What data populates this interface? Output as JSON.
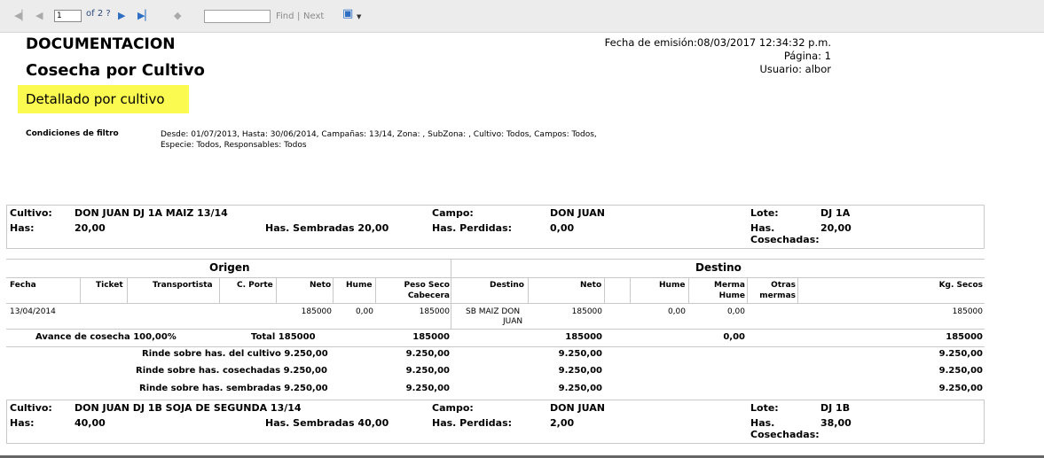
{
  "toolbar": {
    "first_icon": "first-page-icon",
    "prev_icon": "previous-page-icon",
    "page_value": "1",
    "page_of": "of 2 ?",
    "next_icon": "next-page-icon",
    "last_icon": "last-page-icon",
    "back_icon": "back-icon",
    "find_value": "",
    "find_label": "Find",
    "separator": "|",
    "next_label": "Next",
    "export_icon": "save-export-icon",
    "dropdown_icon": "dropdown-arrow-icon"
  },
  "report": {
    "title1": "DOCUMENTACION",
    "title2": "Cosecha por Cultivo",
    "subtitle": "Detallado por cultivo",
    "emision": "Fecha de emisión:08/03/2017 12:34:32 p.m.",
    "pagina": "Página: 1",
    "usuario": "Usuario: albor",
    "filter_label": "Condiciones de filtro",
    "filter_text": "Desde: 01/07/2013, Hasta: 30/06/2014, Campañas: 13/14, Zona: , SubZona: , Cultivo: Todos, Campos: Todos, Especie: Todos, Responsables: Todos"
  },
  "block1": {
    "cultivo_label": "Cultivo:",
    "cultivo_value": "DON JUAN DJ 1A MAIZ 13/14",
    "campo_label": "Campo:",
    "campo_value": "DON JUAN",
    "lote_label": "Lote:",
    "lote_value": "DJ 1A",
    "has_label": "Has:",
    "has_value": "20,00",
    "sembradas": "Has. Sembradas 20,00",
    "perdidas_label": "Has. Perdidas:",
    "perdidas_value": "0,00",
    "cosechadas_label1": "Has.",
    "cosechadas_label2": "Cosechadas:",
    "cosechadas_value": "20,00"
  },
  "table": {
    "origen": "Origen",
    "destino": "Destino",
    "col_fecha": "Fecha",
    "col_ticket": "Ticket",
    "col_transportista": "Transportista",
    "col_cporte": "C. Porte",
    "col_neto": "Neto",
    "col_hume": "Hume",
    "col_pesoseco1": "Peso Seco",
    "col_pesoseco2": "Cabecera",
    "col_destino": "Destino",
    "col_neto2": "Neto",
    "col_hume2": "Hume",
    "col_merma1": "Merma",
    "col_merma2": "Hume",
    "col_otras1": "Otras",
    "col_otras2": "mermas",
    "col_kgsecos": "Kg. Secos",
    "row": {
      "fecha": "13/04/2014",
      "neto": "185000",
      "hume": "0,00",
      "pesoseco": "185000",
      "destino1": "SB MAIZ DON",
      "destino2": "JUAN",
      "neto2": "185000",
      "hume2": "0,00",
      "merma": "0,00",
      "kgsecos": "185000"
    },
    "avance": "Avance de cosecha 100,00%",
    "total": "Total 185000",
    "total_pesoseco": "185000",
    "total_neto2": "185000",
    "total_merma": "0,00",
    "total_kgsecos": "185000",
    "rinde_cultivo": "Rinde sobre has. del cultivo 9.250,00",
    "rinde_cosechadas": "Rinde sobre has. cosechadas 9.250,00",
    "rinde_sembradas": "Rinde sobre has. sembradas 9.250,00",
    "rinde_val": "9.250,00"
  },
  "block2": {
    "cultivo_label": "Cultivo:",
    "cultivo_value": "DON JUAN DJ 1B SOJA DE SEGUNDA 13/14",
    "campo_label": "Campo:",
    "campo_value": "DON JUAN",
    "lote_label": "Lote:",
    "lote_value": "DJ 1B",
    "has_label": "Has:",
    "has_value": "40,00",
    "sembradas": "Has. Sembradas 40,00",
    "perdidas_label": "Has. Perdidas:",
    "perdidas_value": "2,00",
    "cosechadas_label1": "Has.",
    "cosechadas_label2": "Cosechadas:",
    "cosechadas_value": "38,00"
  }
}
